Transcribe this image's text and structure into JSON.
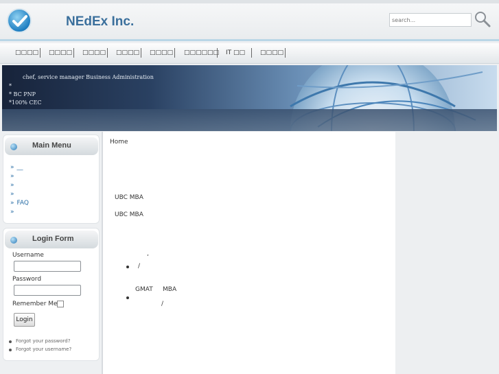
{
  "header": {
    "site_name": "NEdEx Inc.",
    "search_placeholder": "search..."
  },
  "nav": {
    "items": [
      "□□□□",
      "□□□□",
      "□□□□",
      "□□□□",
      "□□□□",
      "□□□□□□",
      "IT □□",
      "□□□□"
    ]
  },
  "banner": {
    "line1": "chef, service manager     Business Administration",
    "line2": "*",
    "line3": "*              BC  PNP",
    "line4": "*100%     CEC"
  },
  "main_menu": {
    "title": "Main Menu",
    "items": [
      "__",
      "",
      "",
      "",
      "FAQ",
      ""
    ]
  },
  "login": {
    "title": "Login Form",
    "username_label": "Username",
    "password_label": "Password",
    "remember_label": "Remember Me",
    "button_label": "Login",
    "forgot_password": "Forgot your password?",
    "forgot_username": "Forgot your username?"
  },
  "content": {
    "breadcrumb": "Home",
    "line1": "UBC MBA",
    "line2": "UBC MBA",
    "mark1": ",",
    "bullet1": "/",
    "gmat": "GMAT",
    "mba": "MBA",
    "bullet2": "/"
  }
}
